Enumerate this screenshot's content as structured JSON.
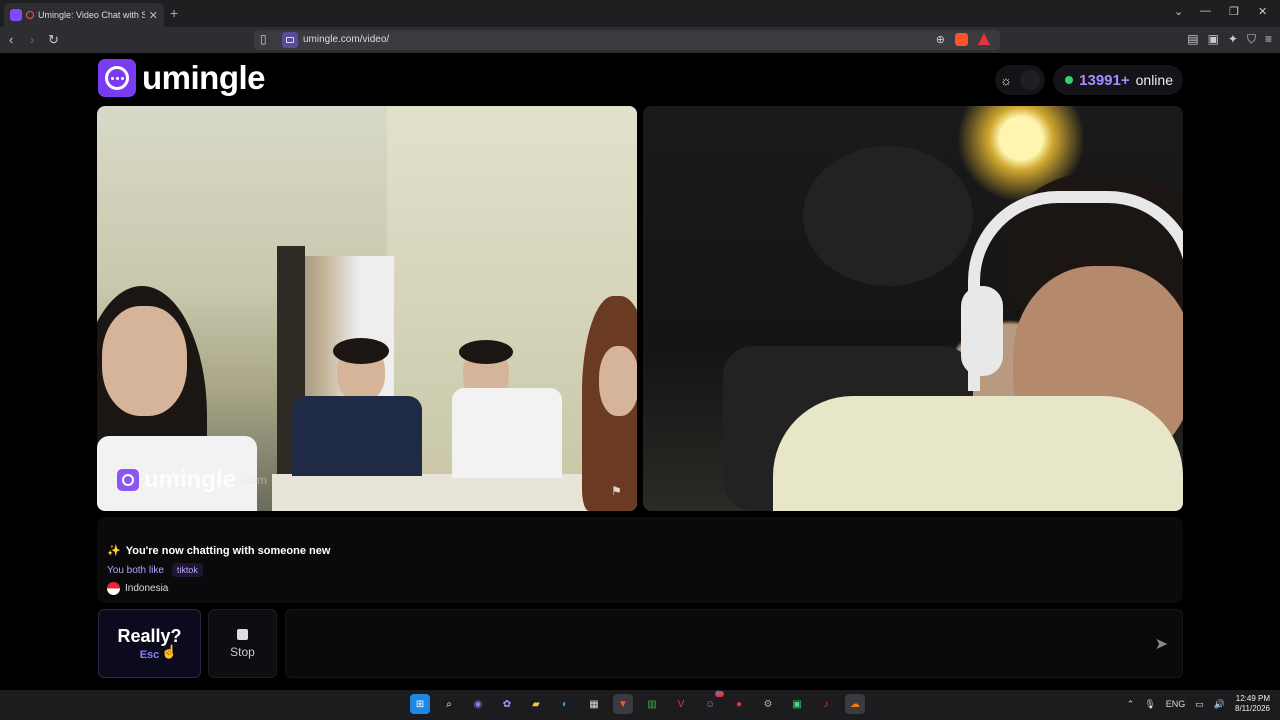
{
  "browser": {
    "tab_title": "Umingle: Video Chat with Str",
    "url": "umingle.com/video/",
    "new_tab_label": "+",
    "tab_close": "✕"
  },
  "header": {
    "logo_text": "umingle",
    "online_count": "13991+",
    "online_label": "online"
  },
  "video": {
    "watermark_text": "umingle",
    "watermark_suffix": ".com"
  },
  "info": {
    "status_message": "You're now chatting with someone new",
    "likes_label": "You both like",
    "interest_tag": "tiktok",
    "country": "Indonesia"
  },
  "controls": {
    "skip_label": "Really?",
    "skip_shortcut": "Esc",
    "stop_label": "Stop",
    "message_placeholder": ""
  },
  "taskbar": {
    "language": "ENG",
    "time": "12:49 PM",
    "date": "8/11/2026",
    "discord_badge": "9+"
  },
  "colors": {
    "brand": "#7a3cf0",
    "online_dot": "#34d36b",
    "accent_text": "#a88bff"
  },
  "icons": {
    "send": "send-icon",
    "stop": "stop-square-icon",
    "theme": "sun-icon",
    "flag": "report-flag-icon"
  }
}
